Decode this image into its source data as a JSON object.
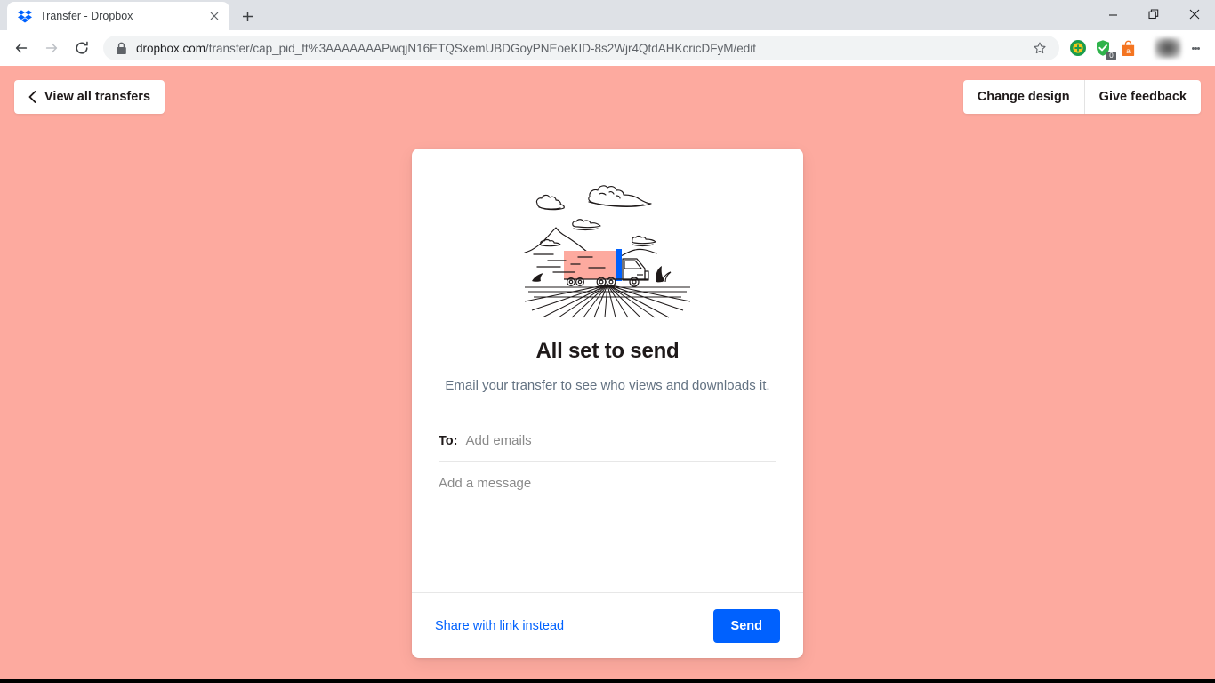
{
  "browser": {
    "tab": {
      "title": "Transfer - Dropbox",
      "favicon_name": "dropbox-favicon",
      "close_icon": "close-icon"
    },
    "new_tab_icon": "plus-icon",
    "window_controls": {
      "minimize": "minimize-icon",
      "restore": "restore-icon",
      "close": "close-icon"
    },
    "nav": {
      "back_icon": "back-arrow-icon",
      "forward_icon": "forward-arrow-icon",
      "reload_icon": "reload-icon"
    },
    "omnibox": {
      "lock_icon": "lock-icon",
      "url_domain": "dropbox.com",
      "url_path": "/transfer/cap_pid_ft%3AAAAAAAPwqjN16ETQSxemUBDGoyPNEoeKID-8s2Wjr4QtdAHKcricDFyM/edit",
      "star_icon": "bookmark-star-icon"
    },
    "extensions": [
      {
        "name": "extension-icon-green-plus",
        "color": "#f5c518"
      },
      {
        "name": "extension-icon-shield-check",
        "color": "#2fb34b",
        "badge": "0"
      },
      {
        "name": "extension-icon-orange-bag",
        "color": "#f47521"
      }
    ],
    "profile_avatar": "profile-avatar",
    "menu_icon": "kebab-menu-icon"
  },
  "page": {
    "background_color": "#fdaa9f",
    "header": {
      "back_icon": "chevron-left-icon",
      "view_all_transfers": "View all transfers",
      "change_design": "Change design",
      "give_feedback": "Give feedback"
    },
    "card": {
      "illustration_name": "truck-landscape-illustration",
      "title": "All set to send",
      "subtitle": "Email your transfer to see who views and downloads it.",
      "to_label": "To:",
      "to_placeholder": "Add emails",
      "to_value": "",
      "message_placeholder": "Add a message",
      "message_value": "",
      "share_link_label": "Share with link instead",
      "send_label": "Send",
      "accent_color": "#0061fe"
    }
  }
}
